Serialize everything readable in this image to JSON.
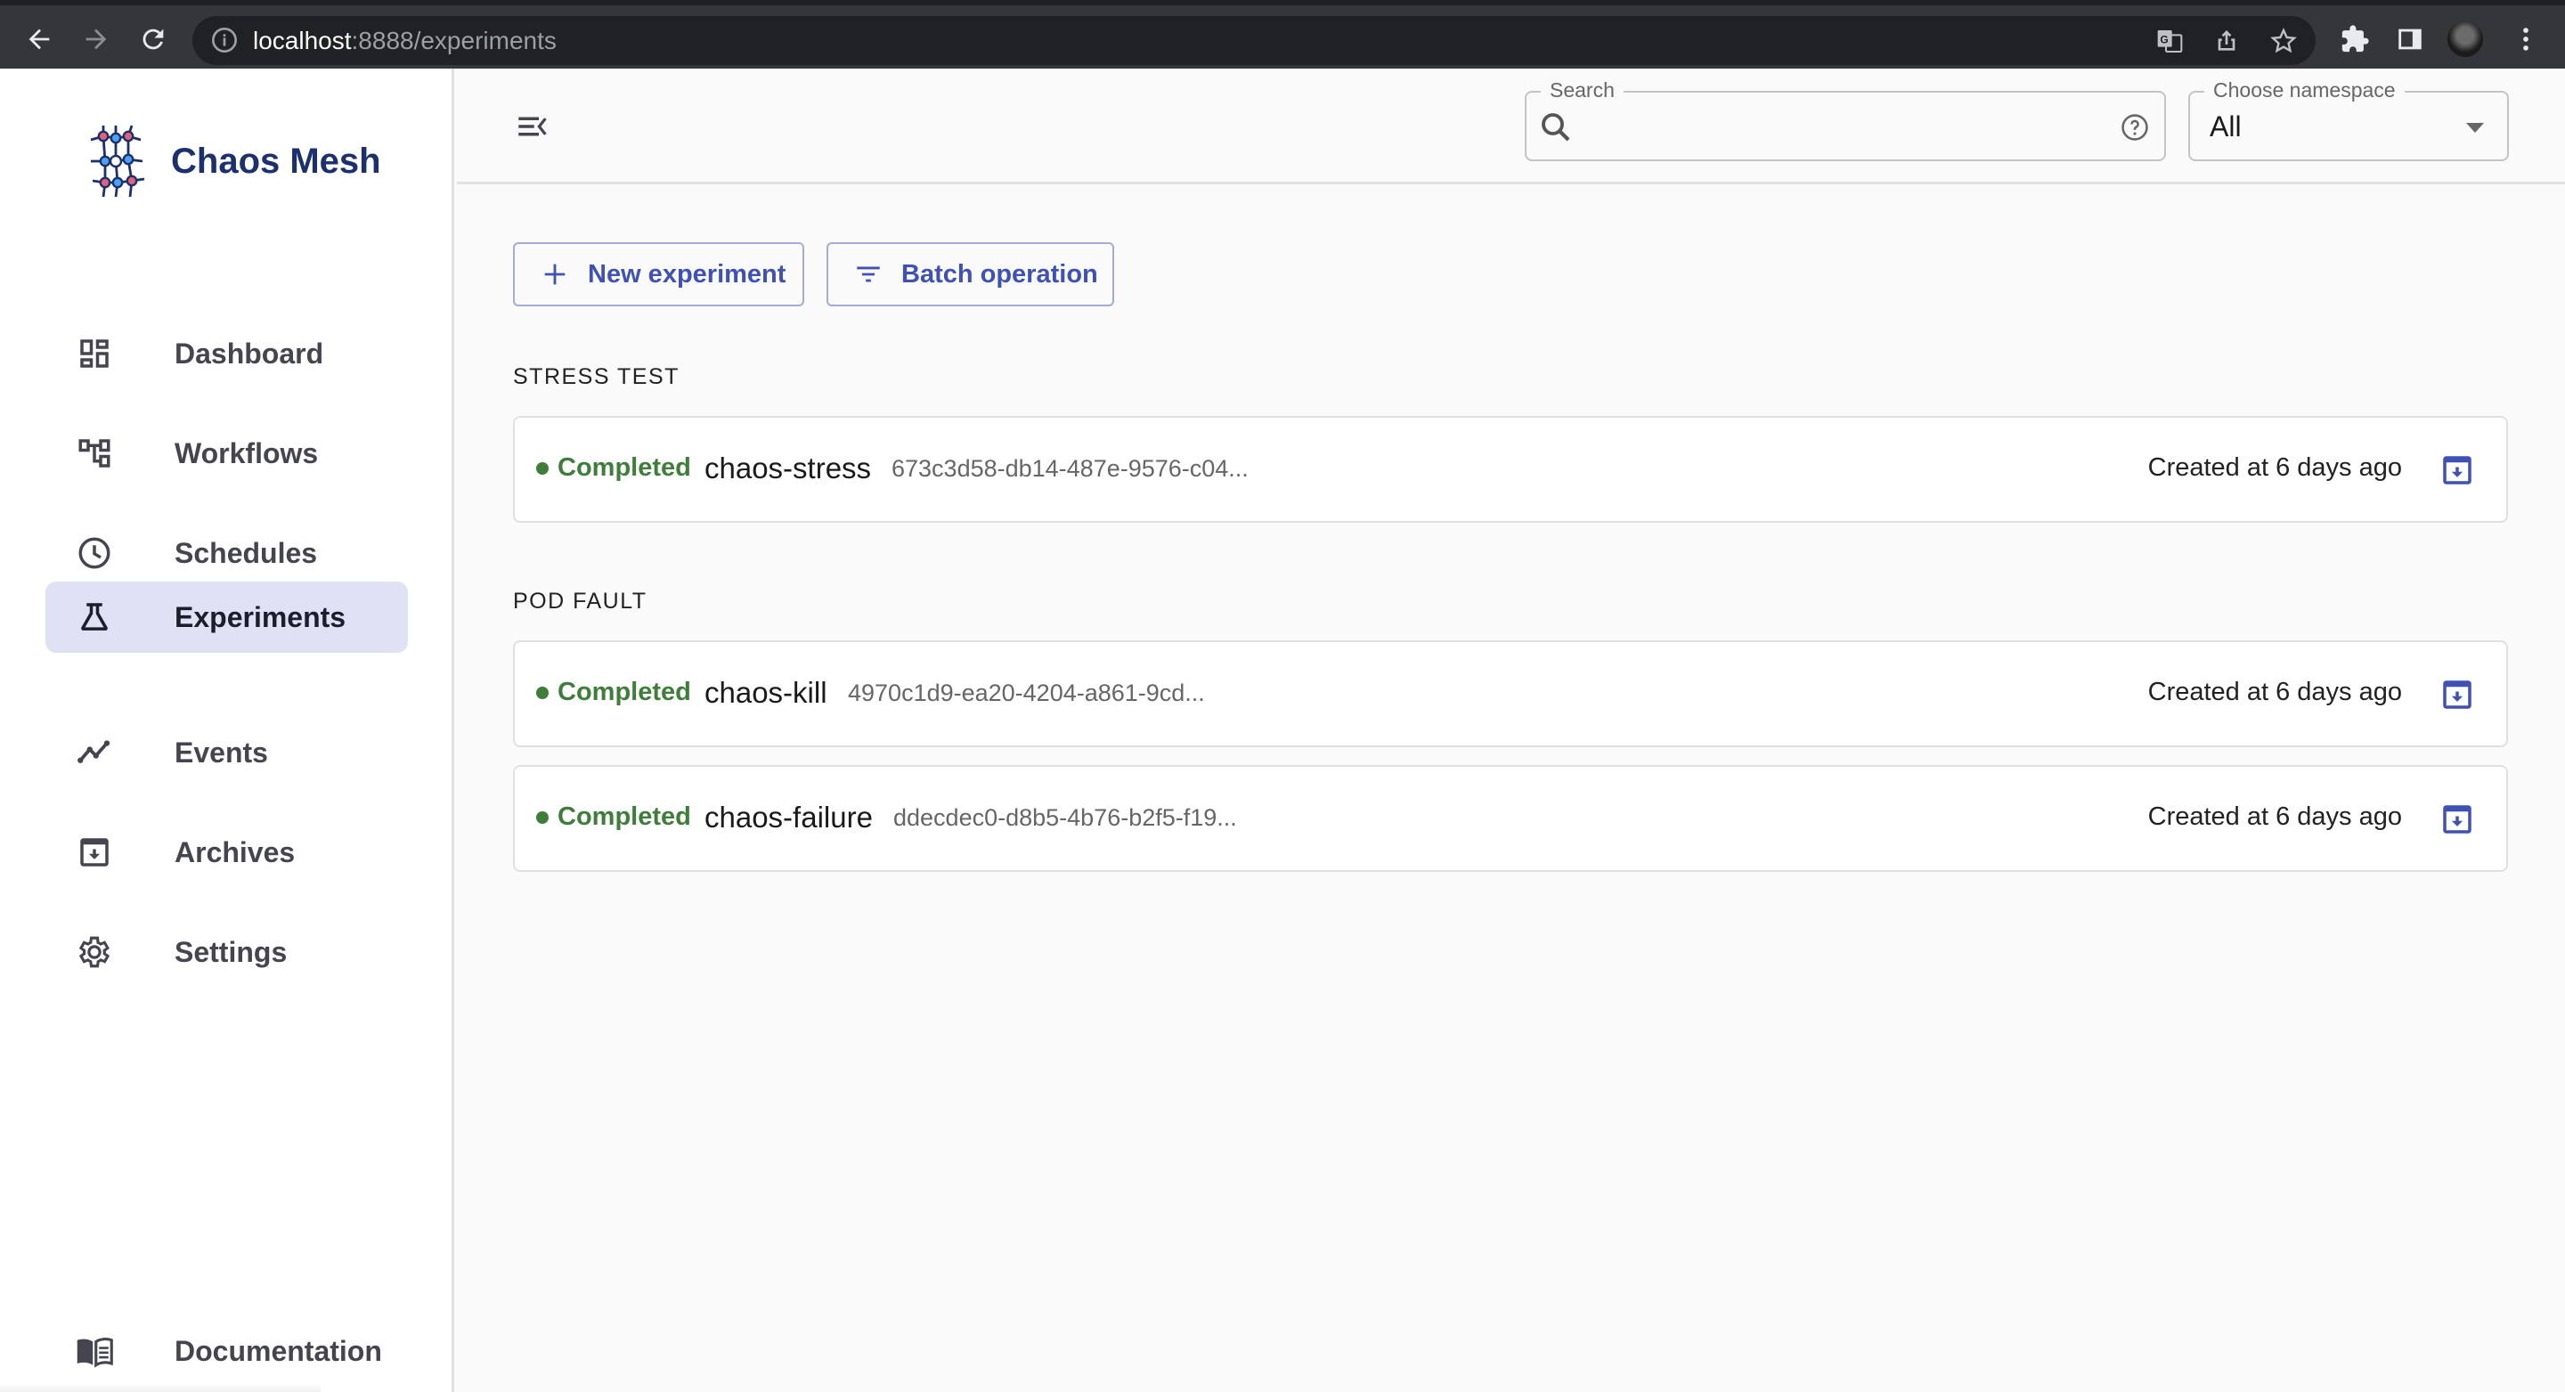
{
  "browser": {
    "url_host": "localhost",
    "url_path": ":8888/experiments"
  },
  "app": {
    "brand": "Chaos Mesh",
    "colors": {
      "primary": "#3f51b5",
      "brand_text": "#1c2f6e",
      "active_nav_bg": "#dfe1f5",
      "status_completed": "#3f7d3a"
    }
  },
  "sidebar": {
    "items": [
      {
        "label": "Dashboard",
        "icon": "dashboard-icon",
        "active": false
      },
      {
        "label": "Workflows",
        "icon": "workflow-icon",
        "active": false
      },
      {
        "label": "Schedules",
        "icon": "clock-icon",
        "active": false
      },
      {
        "label": "Experiments",
        "icon": "flask-icon",
        "active": true
      },
      {
        "label": "Events",
        "icon": "timeline-icon",
        "active": false
      },
      {
        "label": "Archives",
        "icon": "archive-icon",
        "active": false
      },
      {
        "label": "Settings",
        "icon": "gear-icon",
        "active": false
      }
    ],
    "footer": {
      "label": "Documentation",
      "icon": "book-icon"
    }
  },
  "header": {
    "search": {
      "label": "Search",
      "value": "",
      "placeholder": ""
    },
    "namespace": {
      "label": "Choose namespace",
      "selected": "All"
    }
  },
  "toolbar": {
    "new_experiment_label": "New experiment",
    "batch_operation_label": "Batch operation"
  },
  "groups": [
    {
      "title": "STRESS TEST",
      "experiments": [
        {
          "status": "Completed",
          "name": "chaos-stress",
          "uid": "673c3d58-db14-487e-9576-c04...",
          "created": "Created at 6 days ago"
        }
      ]
    },
    {
      "title": "POD FAULT",
      "experiments": [
        {
          "status": "Completed",
          "name": "chaos-kill",
          "uid": "4970c1d9-ea20-4204-a861-9cd...",
          "created": "Created at 6 days ago"
        },
        {
          "status": "Completed",
          "name": "chaos-failure",
          "uid": "ddecdec0-d8b5-4b76-b2f5-f19...",
          "created": "Created at 6 days ago"
        }
      ]
    }
  ]
}
